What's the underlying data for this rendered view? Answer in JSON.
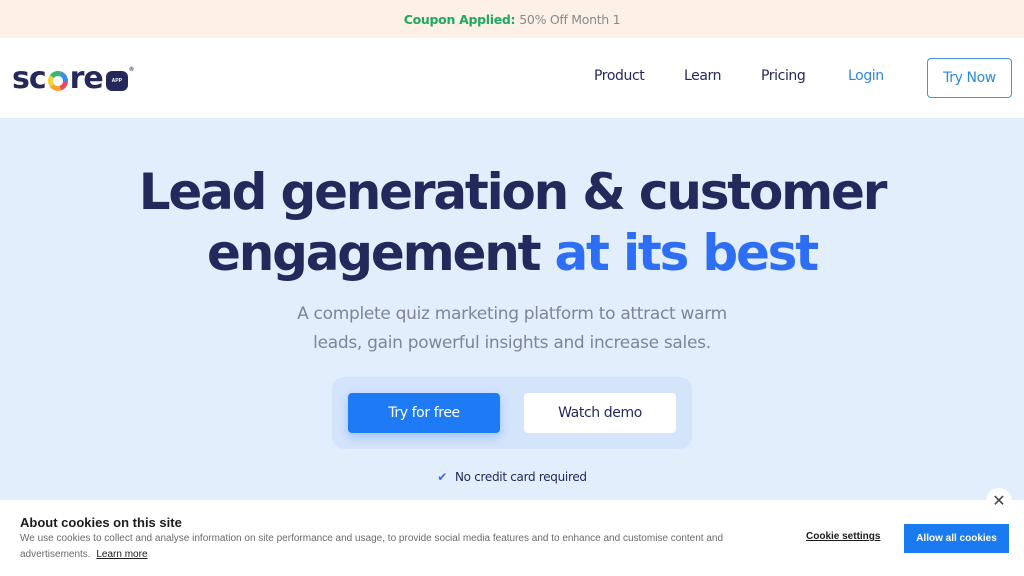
{
  "coupon": {
    "label": "Coupon Applied:",
    "value": "50% Off Month 1",
    "label_color": "#1faa5e"
  },
  "nav": {
    "logo": {
      "text_before": "sc",
      "text_after": "re",
      "badge": "APP",
      "registered": "®"
    },
    "links": [
      {
        "label": "Product"
      },
      {
        "label": "Learn"
      },
      {
        "label": "Pricing"
      },
      {
        "label": "Login"
      }
    ],
    "cta": "Try Now"
  },
  "hero": {
    "title_line1": "Lead generation & customer",
    "title_line2_plain": "engagement ",
    "title_line2_highlight": "at its best",
    "subtitle_line1": "A complete quiz marketing platform to attract warm",
    "subtitle_line2": "leads, gain powerful insights and increase sales.",
    "primary_button": "Try for free",
    "secondary_button": "Watch demo",
    "note_icon": "check-icon",
    "note": "No credit card required",
    "accent_color": "#2e6ef5",
    "primary_color": "#1f7af5",
    "title_color": "#24285b"
  },
  "cookie_banner": {
    "title": "About cookies on this site",
    "text": "We use cookies to collect and analyse information on site performance and usage, to provide social media features and to enhance and customise content and advertisements.",
    "learn_more": "Learn more",
    "settings": "Cookie settings",
    "allow_all": "Allow all cookies",
    "close_icon": "close-icon",
    "close_glyph": "✕"
  }
}
